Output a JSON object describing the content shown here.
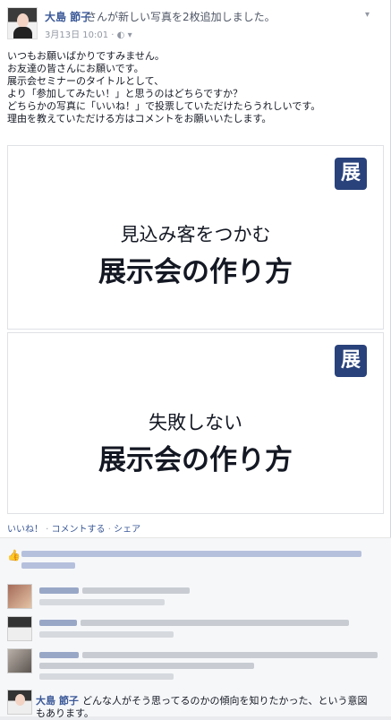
{
  "post": {
    "author": "大島 節子",
    "action": "さんが新しい写真を2枚追加しました。",
    "date": "3月13日 10:01 ·",
    "privacy_icon": "globe-icon",
    "menu_icon": "chevron-down-icon"
  },
  "message": {
    "lines": [
      "いつもお願いばかりですみません。",
      "お友達の皆さんにお願いです。",
      "展示会セミナーのタイトルとして、",
      "より「参加してみたい！」と思うのはどちらですか？",
      "どちらかの写真に「いいね！」で投票していただけたらうれしいです。",
      "理由を教えていただける方はコメントをお願いいたします。"
    ]
  },
  "photos": [
    {
      "badge": "展",
      "subtitle": "見込み客をつかむ",
      "title": "展示会の作り方"
    },
    {
      "badge": "展",
      "subtitle": "失敗しない",
      "title": "展示会の作り方"
    }
  ],
  "actions": {
    "like": "いいね！",
    "comment": "コメントする",
    "share": "シェア",
    "separator": " · "
  },
  "last_comment": {
    "author": "大島 節子",
    "text": "どんな人がそう思ってるのかの傾向を知りたかった、という意図",
    "text2": "もあります。"
  },
  "colors": {
    "link": "#3b5998",
    "badge": "#29427b",
    "background": "#f6f7f9"
  }
}
